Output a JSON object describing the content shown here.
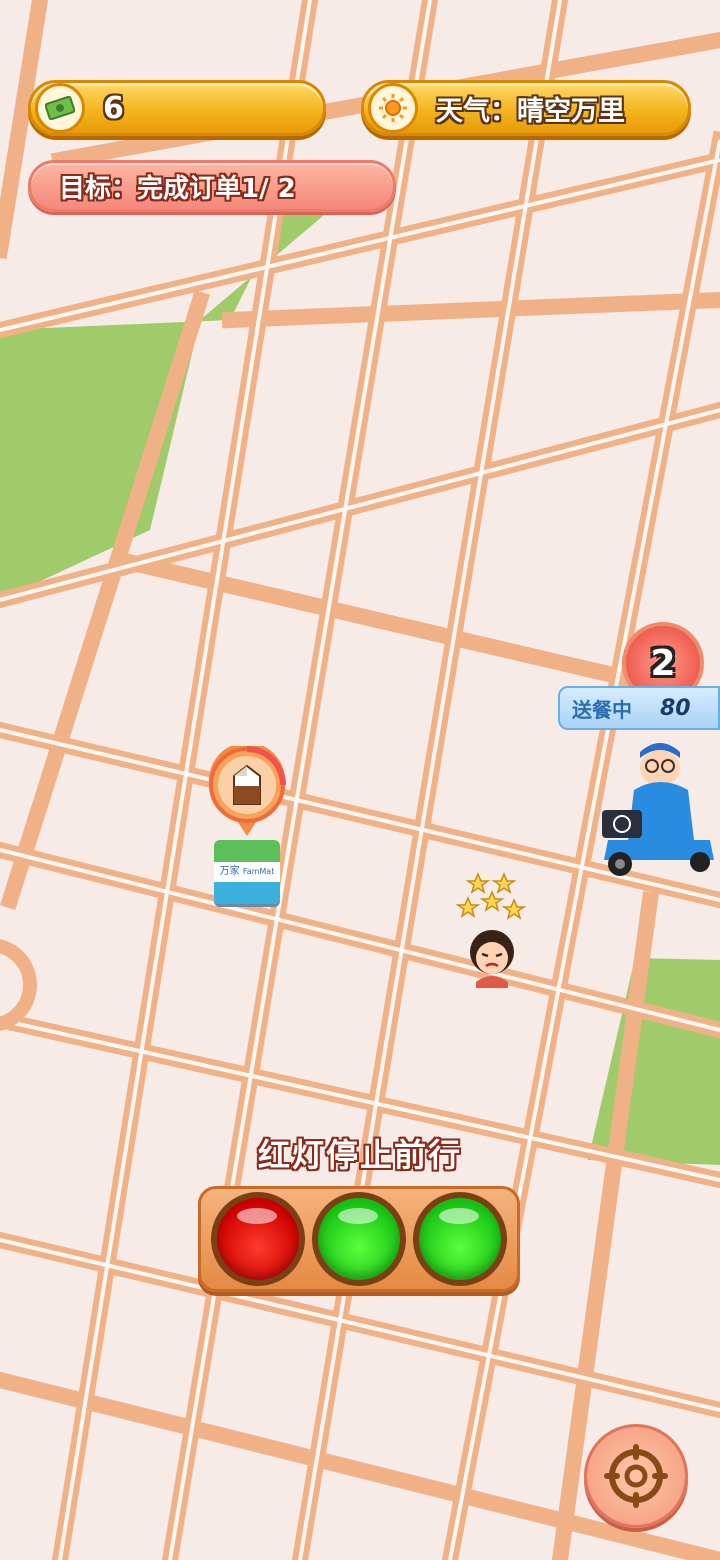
{
  "hud": {
    "money": "6",
    "money_icon": "cash-icon",
    "weather_icon": "sun-icon",
    "weather": "天气：晴空万里",
    "goal": "目标：完成订单1/ 2"
  },
  "store": {
    "product_icon": "milk-carton-icon",
    "sign_text": "万家 FamMat",
    "sign_line1": "万家",
    "sign_line2": "FamMat"
  },
  "delivery": {
    "order_count": "2",
    "status_label": "送餐中",
    "status_value": "80"
  },
  "traffic": {
    "instruction": "红灯停止前行",
    "lights": [
      "red",
      "green",
      "green"
    ]
  },
  "controls": {
    "compass_icon": "compass-icon"
  },
  "colors": {
    "road": "#f0b186",
    "block": "#f6ebe6",
    "park": "#9fcb6b",
    "accent_gold": "#f4b51c"
  }
}
